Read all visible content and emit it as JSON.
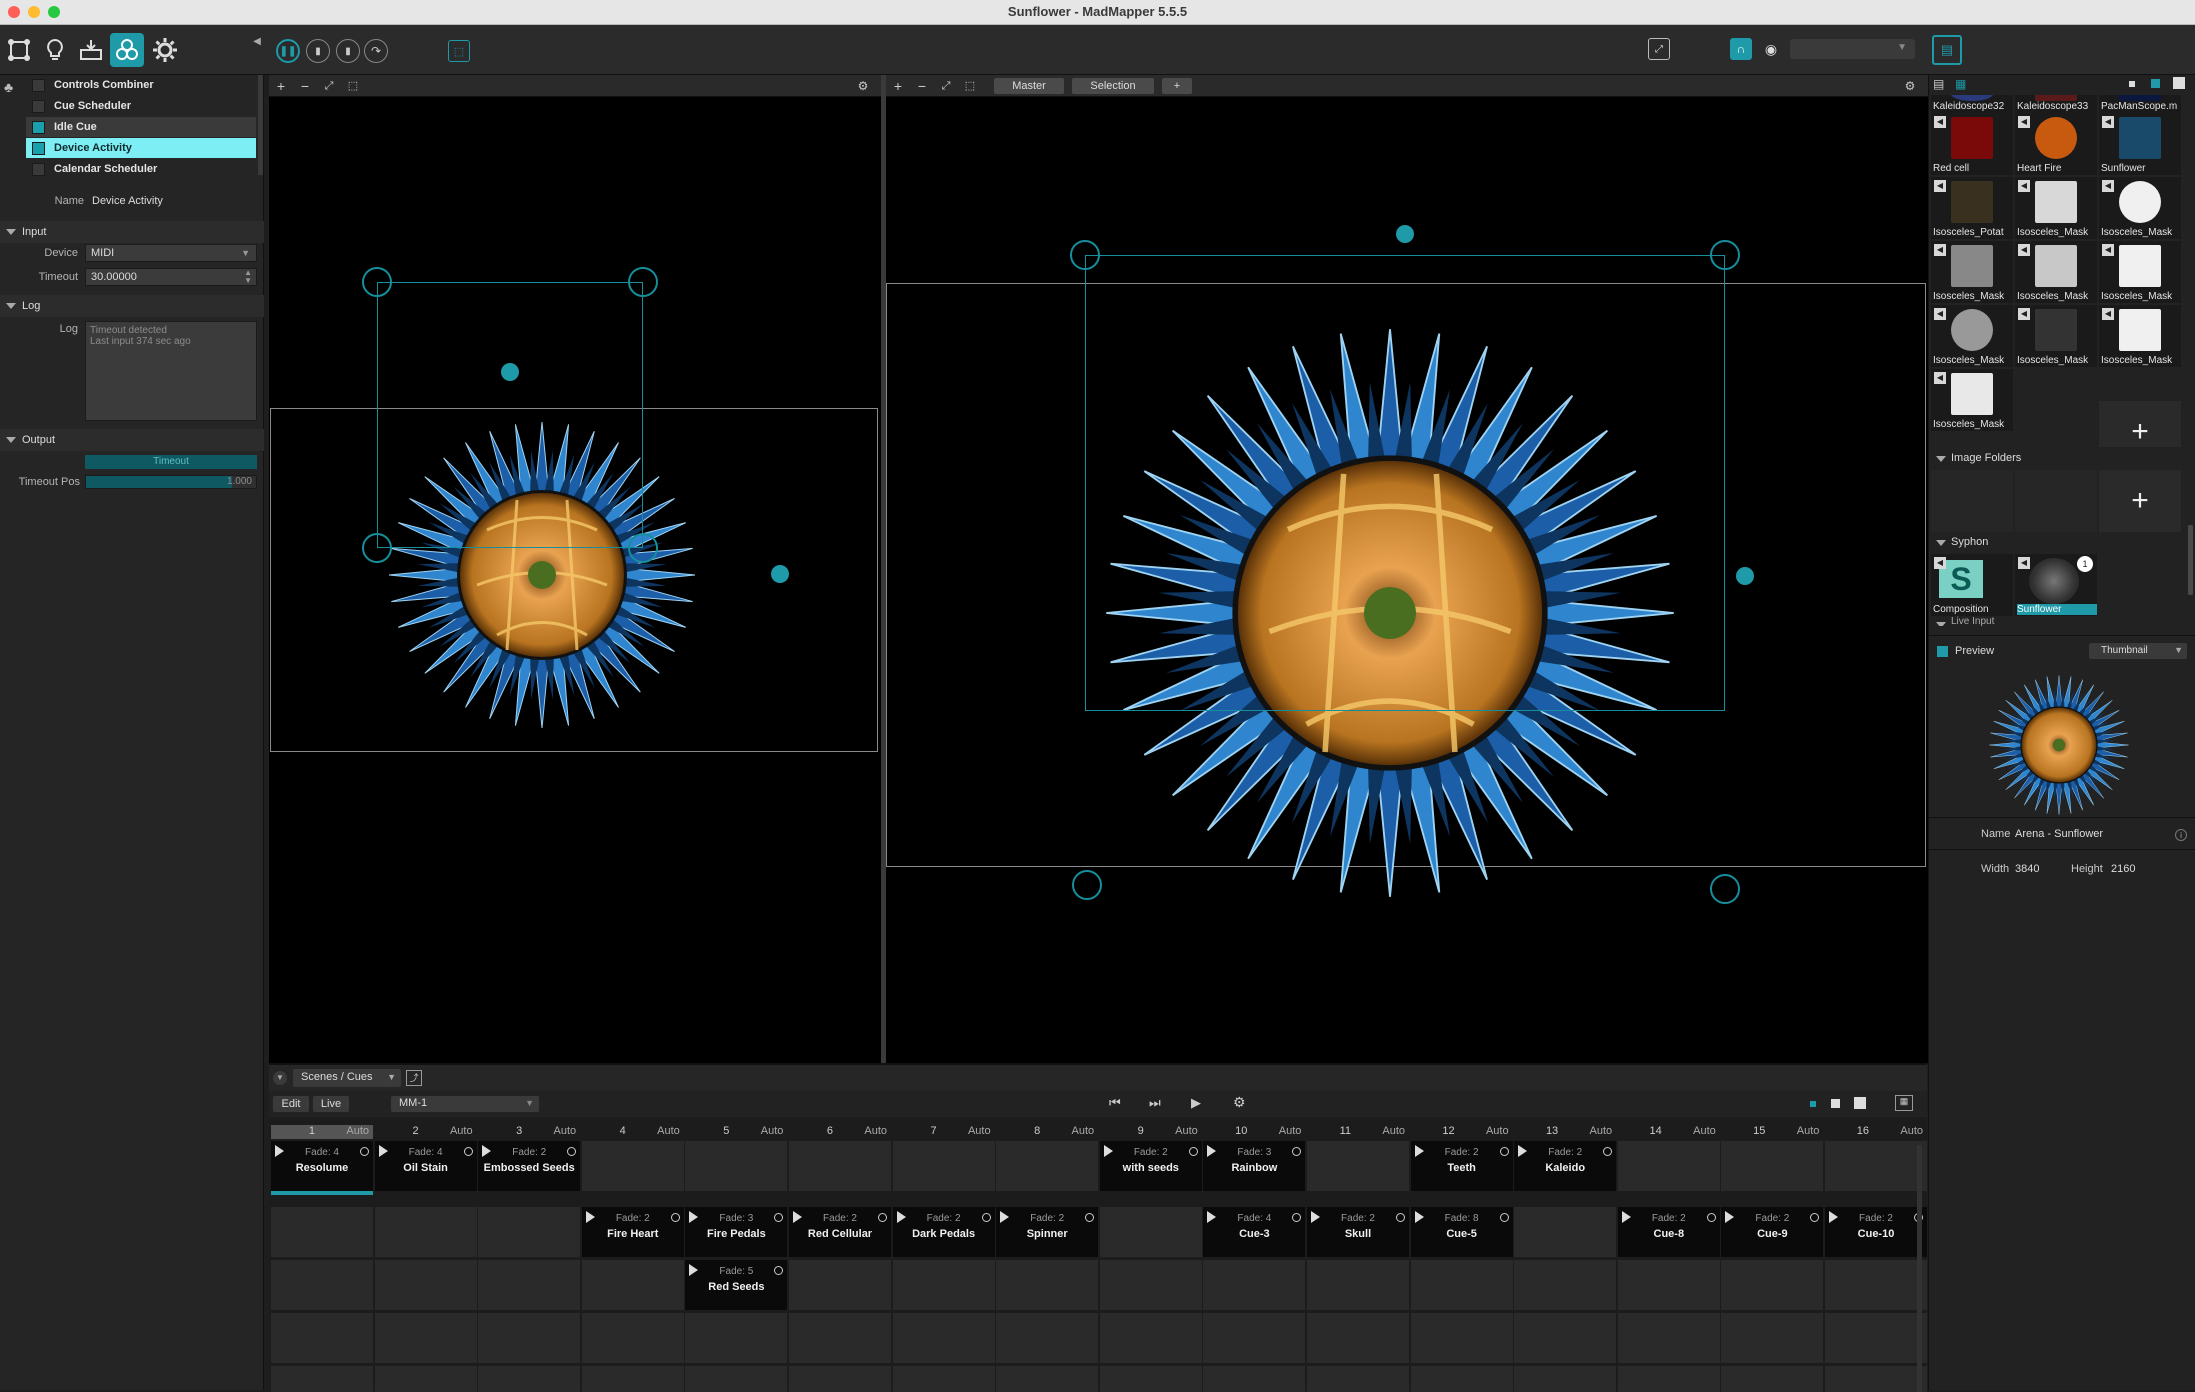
{
  "window": {
    "title": "Sunflower - MadMapper 5.5.5"
  },
  "toolbar": {
    "left_icons": [
      "surfaces-icon",
      "lightbulb-icon",
      "output-icon",
      "modules-icon",
      "settings-gear-icon"
    ],
    "transport_icons": [
      "pause-icon",
      "stop-icon",
      "step-icon",
      "loop-icon",
      "save-icon"
    ],
    "right_dropdown": ""
  },
  "modules": {
    "items": [
      {
        "label": "Controls Combiner",
        "selected": false
      },
      {
        "label": "Cue Scheduler",
        "selected": false
      },
      {
        "label": "Idle Cue",
        "selected": false
      },
      {
        "label": "Device Activity",
        "selected": true
      },
      {
        "label": "Calendar Scheduler",
        "selected": false
      }
    ]
  },
  "props": {
    "name_label": "Name",
    "name_value": "Device Activity",
    "input_section": "Input",
    "device_label": "Device",
    "device_value": "MIDI",
    "timeout_label": "Timeout",
    "timeout_value": "30.00000",
    "log_section": "Log",
    "log_label": "Log",
    "log_line1": "Timeout detected",
    "log_line2": "Last input 374 sec ago",
    "output_section": "Output",
    "timeout_bar_label": "Timeout",
    "timeout_pos_label": "Timeout Pos",
    "timeout_pos_value": "1.000",
    "timeout_pos_fraction": 0.86
  },
  "viewer": {
    "master_tab": "Master",
    "selection_tab": "Selection",
    "add_tab": "+"
  },
  "library": {
    "media": [
      {
        "caption": "Kaleidoscope32"
      },
      {
        "caption": "Kaleidoscope33"
      },
      {
        "caption": "PacManScope.m"
      },
      {
        "caption": "Red cell"
      },
      {
        "caption": "Heart Fire"
      },
      {
        "caption": "Sunflower"
      },
      {
        "caption": "Isosceles_Potat"
      },
      {
        "caption": "Isosceles_Mask"
      },
      {
        "caption": "Isosceles_Mask"
      },
      {
        "caption": "Isosceles_Mask"
      },
      {
        "caption": "Isosceles_Mask"
      },
      {
        "caption": "Isosceles_Mask"
      },
      {
        "caption": "Isosceles_Mask"
      },
      {
        "caption": "Isosceles_Mask"
      },
      {
        "caption": "Isosceles_Mask"
      },
      {
        "caption": "Isosceles_Mask"
      }
    ],
    "image_folders": "Image Folders",
    "syphon": "Syphon",
    "syphon_items": [
      {
        "caption": "Composition"
      },
      {
        "caption": "Sunflower",
        "badge": "1"
      }
    ],
    "live_input": "Live Input",
    "plus": "+"
  },
  "preview": {
    "label": "Preview",
    "mode": "Thumbnail",
    "name_label": "Name",
    "name_value": "Arena - Sunflower",
    "width_label": "Width",
    "width_value": "3840",
    "height_label": "Height",
    "height_value": "2160"
  },
  "cues": {
    "panel_name": "Scenes / Cues",
    "edit_button": "Edit",
    "live_button": "Live",
    "page_select": "MM-1",
    "columns": [
      {
        "n": "1",
        "a": "Auto"
      },
      {
        "n": "2",
        "a": "Auto"
      },
      {
        "n": "3",
        "a": "Auto"
      },
      {
        "n": "4",
        "a": "Auto"
      },
      {
        "n": "5",
        "a": "Auto"
      },
      {
        "n": "6",
        "a": "Auto"
      },
      {
        "n": "7",
        "a": "Auto"
      },
      {
        "n": "8",
        "a": "Auto"
      },
      {
        "n": "9",
        "a": "Auto"
      },
      {
        "n": "10",
        "a": "Auto"
      },
      {
        "n": "11",
        "a": "Auto"
      },
      {
        "n": "12",
        "a": "Auto"
      },
      {
        "n": "13",
        "a": "Auto"
      },
      {
        "n": "14",
        "a": "Auto"
      },
      {
        "n": "15",
        "a": "Auto"
      },
      {
        "n": "16",
        "a": "Auto"
      }
    ],
    "items": [
      {
        "row": 0,
        "col": 0,
        "fade": "Fade: 4",
        "name": "Resolume",
        "active": true
      },
      {
        "row": 0,
        "col": 1,
        "fade": "Fade: 4",
        "name": "Oil Stain"
      },
      {
        "row": 0,
        "col": 2,
        "fade": "Fade: 2",
        "name": "Embossed Seeds"
      },
      {
        "row": 0,
        "col": 8,
        "fade": "Fade: 2",
        "name": "with seeds"
      },
      {
        "row": 0,
        "col": 9,
        "fade": "Fade: 3",
        "name": "Rainbow"
      },
      {
        "row": 0,
        "col": 11,
        "fade": "Fade: 2",
        "name": "Teeth"
      },
      {
        "row": 0,
        "col": 12,
        "fade": "Fade: 2",
        "name": "Kaleido"
      },
      {
        "row": 1,
        "col": 3,
        "fade": "Fade: 2",
        "name": "Fire Heart"
      },
      {
        "row": 1,
        "col": 4,
        "fade": "Fade: 3",
        "name": "Fire Pedals"
      },
      {
        "row": 1,
        "col": 5,
        "fade": "Fade: 2",
        "name": "Red Cellular"
      },
      {
        "row": 1,
        "col": 6,
        "fade": "Fade: 2",
        "name": "Dark Pedals"
      },
      {
        "row": 1,
        "col": 7,
        "fade": "Fade: 2",
        "name": "Spinner"
      },
      {
        "row": 1,
        "col": 9,
        "fade": "Fade: 4",
        "name": "Cue-3"
      },
      {
        "row": 1,
        "col": 10,
        "fade": "Fade: 2",
        "name": "Skull"
      },
      {
        "row": 1,
        "col": 11,
        "fade": "Fade: 8",
        "name": "Cue-5"
      },
      {
        "row": 1,
        "col": 13,
        "fade": "Fade: 2",
        "name": "Cue-8"
      },
      {
        "row": 1,
        "col": 14,
        "fade": "Fade: 2",
        "name": "Cue-9"
      },
      {
        "row": 1,
        "col": 15,
        "fade": "Fade: 2",
        "name": "Cue-10"
      },
      {
        "row": 2,
        "col": 4,
        "fade": "Fade: 5",
        "name": "Red Seeds"
      }
    ]
  },
  "colors": {
    "accent": "#1e9aa8",
    "selection": "#7deff4",
    "bg": "#1e1e1e"
  }
}
